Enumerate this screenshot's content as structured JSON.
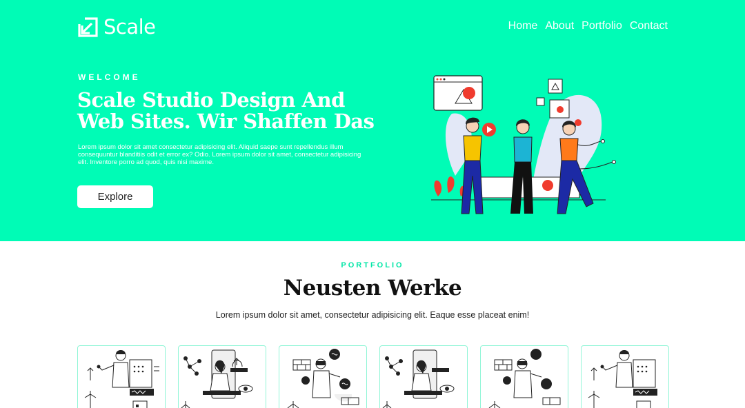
{
  "brand": {
    "name": "Scale",
    "logo_icon": "arrow-box-icon"
  },
  "nav": {
    "items": [
      {
        "label": "Home"
      },
      {
        "label": "About"
      },
      {
        "label": "Portfolio"
      },
      {
        "label": "Contact"
      }
    ]
  },
  "hero": {
    "eyebrow": "WELCOME",
    "title": "Scale Studio Design And Web Sites. Wir Shaffen Das",
    "description": "Lorem ipsum dolor sit amet consectetur adipisicing elit. Aliquid saepe sunt repellendus illum consequuntur blanditiis odit et error ex? Odio. Lorem ipsum dolor sit amet, consectetur adipisicing elit. Inventore porro ad quod, quis nisi maxime.",
    "button_label": "Explore",
    "background_color": "#00fcb6"
  },
  "portfolio": {
    "eyebrow": "PORTFOLIO",
    "title": "Neusten Werke",
    "description": "Lorem ipsum dolor sit amet, consectetur adipisicing elit. Eaque esse placeat enim!",
    "accent_color": "#00e6a6",
    "cards": [
      {
        "illustration": "person-presenting"
      },
      {
        "illustration": "person-meditating"
      },
      {
        "illustration": "person-vr"
      },
      {
        "illustration": "person-meditating"
      },
      {
        "illustration": "person-vr"
      },
      {
        "illustration": "person-presenting"
      }
    ]
  }
}
